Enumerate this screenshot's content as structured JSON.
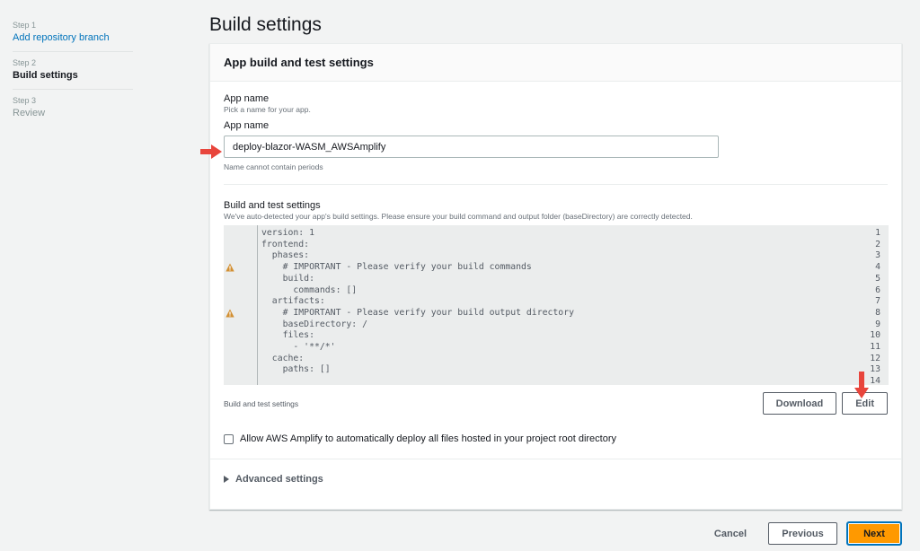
{
  "steps": [
    {
      "step": "Step 1",
      "label": "Add repository branch",
      "state": "link"
    },
    {
      "step": "Step 2",
      "label": "Build settings",
      "state": "current"
    },
    {
      "step": "Step 3",
      "label": "Review",
      "state": "disabled"
    }
  ],
  "page_title": "Build settings",
  "card": {
    "title": "App build and test settings",
    "app_name": {
      "section_label": "App name",
      "section_desc": "Pick a name for your app.",
      "field_label": "App name",
      "value": "deploy-blazor-WASM_AWSAmplify",
      "hint": "Name cannot contain periods"
    },
    "build": {
      "label": "Build and test settings",
      "desc": "We've auto-detected your app's build settings. Please ensure your build command and output folder (baseDirectory) are correctly detected.",
      "code_lines": [
        {
          "n": "1",
          "text": "version: 1",
          "warn": false
        },
        {
          "n": "2",
          "text": "frontend:",
          "warn": false
        },
        {
          "n": "3",
          "text": "  phases:",
          "warn": false
        },
        {
          "n": "4",
          "text": "    # IMPORTANT - Please verify your build commands",
          "warn": true
        },
        {
          "n": "5",
          "text": "    build:",
          "warn": false
        },
        {
          "n": "6",
          "text": "      commands: []",
          "warn": false
        },
        {
          "n": "7",
          "text": "  artifacts:",
          "warn": false
        },
        {
          "n": "8",
          "text": "    # IMPORTANT - Please verify your build output directory",
          "warn": true
        },
        {
          "n": "9",
          "text": "    baseDirectory: /",
          "warn": false
        },
        {
          "n": "10",
          "text": "    files:",
          "warn": false
        },
        {
          "n": "11",
          "text": "      - '**/*'",
          "warn": false
        },
        {
          "n": "12",
          "text": "  cache:",
          "warn": false
        },
        {
          "n": "13",
          "text": "    paths: []",
          "warn": false
        },
        {
          "n": "14",
          "text": "",
          "warn": false
        }
      ],
      "footer_label": "Build and test settings",
      "download_label": "Download",
      "edit_label": "Edit"
    },
    "checkbox_label": "Allow AWS Amplify to automatically deploy all files hosted in your project root directory",
    "checkbox_checked": false,
    "advanced_label": "Advanced settings"
  },
  "actions": {
    "cancel_label": "Cancel",
    "previous_label": "Previous",
    "next_label": "Next"
  },
  "colors": {
    "accent": "#ff9900",
    "link": "#0073bb",
    "annotation_arrow": "#e8453c",
    "warning": "#d29034"
  }
}
